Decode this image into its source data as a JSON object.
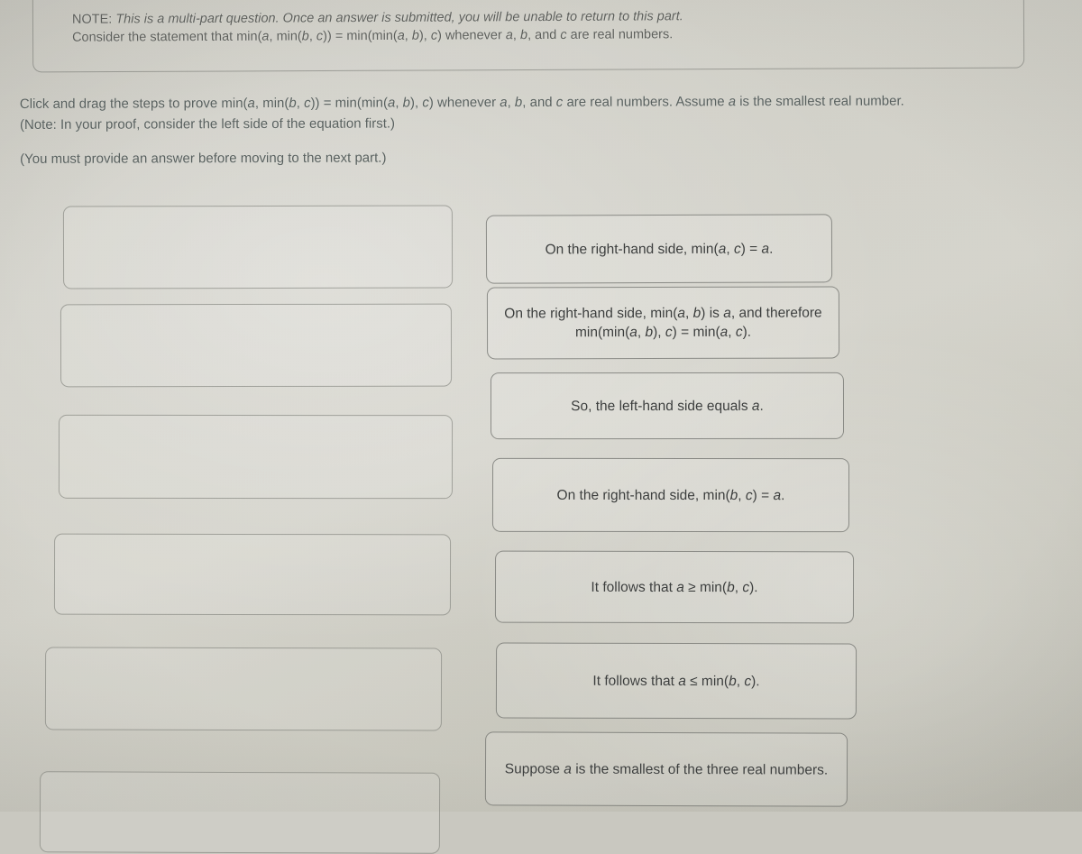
{
  "note": {
    "label": "NOTE:",
    "line1_italic": "This is a multi-part question. Once an answer is submitted, you will be unable to return to this part.",
    "line2": "Consider the statement that min(a, min(b, c)) = min(min(a, b), c) whenever a, b, and c are real numbers."
  },
  "prompt": {
    "main": "Click and drag the steps to prove min(a, min(b, c)) = min(min(a, b), c) whenever a, b, and c are real numbers. Assume a is the smallest real number.",
    "hint": "(Note: In your proof, consider the left side of the equation first.)",
    "warning": "(You must provide an answer before moving to the next part.)"
  },
  "drop_zone": {
    "slot_count": 6,
    "slots": [
      {
        "value": "",
        "placeholder": ""
      },
      {
        "value": "",
        "placeholder": ""
      },
      {
        "value": "",
        "placeholder": ""
      },
      {
        "value": "",
        "placeholder": ""
      },
      {
        "value": "",
        "placeholder": ""
      },
      {
        "value": "",
        "placeholder": ""
      }
    ]
  },
  "steps": [
    {
      "id": "step-1",
      "label": "On the right-hand side, min(a, c) = a."
    },
    {
      "id": "step-2",
      "label": "On the right-hand side, min(a, b) is a, and therefore min(min(a, b), c) = min(a, c)."
    },
    {
      "id": "step-3",
      "label": "So, the left-hand side equals a."
    },
    {
      "id": "step-4",
      "label": "On the right-hand side, min(b, c) = a."
    },
    {
      "id": "step-5",
      "label": "It follows that a ≥ min(b, c)."
    },
    {
      "id": "step-6",
      "label": "It follows that a ≤ min(b, c)."
    },
    {
      "id": "step-7",
      "label": "Suppose a is the smallest of the three real numbers."
    }
  ],
  "colors": {
    "background": "#c9c8c0",
    "note_text": "#5c5e5a",
    "prompt_text": "#58605e",
    "card_text": "#3b3d3c",
    "card_border": "#696b66",
    "slot_border": "#7a7c76"
  }
}
